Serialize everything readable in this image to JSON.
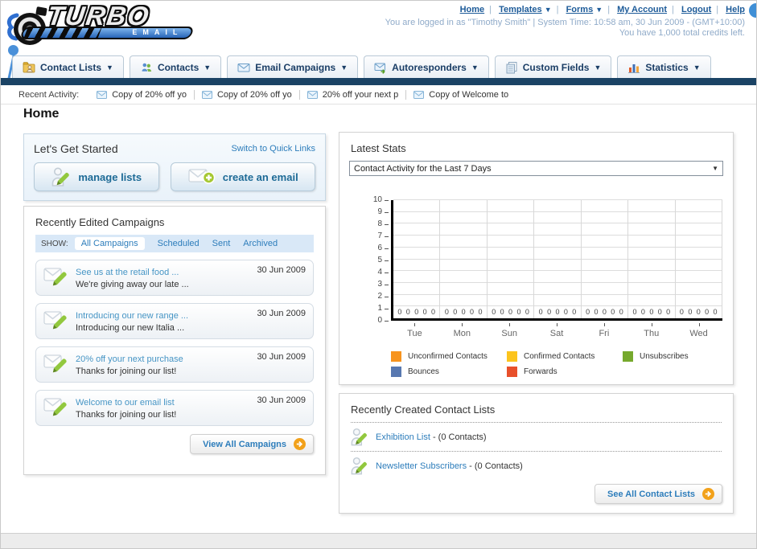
{
  "logo": {
    "title": "TURBO",
    "subtitle": "EMAIL"
  },
  "topnav": {
    "links": [
      {
        "label": "Home",
        "dropdown": false
      },
      {
        "label": "Templates",
        "dropdown": true
      },
      {
        "label": "Forms",
        "dropdown": true
      },
      {
        "label": "My Account",
        "dropdown": false
      },
      {
        "label": "Logout",
        "dropdown": false
      },
      {
        "label": "Help",
        "dropdown": false
      }
    ],
    "status_line1": "You are logged in as \"Timothy Smith\" | System Time: 10:58 am, 30 Jun 2009 - (GMT+10:00)",
    "status_line2": "You have 1,000 total credits left."
  },
  "tabs": [
    {
      "label": "Contact Lists"
    },
    {
      "label": "Contacts"
    },
    {
      "label": "Email Campaigns"
    },
    {
      "label": "Autoresponders"
    },
    {
      "label": "Custom Fields"
    },
    {
      "label": "Statistics"
    }
  ],
  "recent_activity": {
    "label": "Recent Activity:",
    "items": [
      "Copy of 20% off yo",
      "Copy of 20% off yo",
      "20% off your next p",
      "Copy of Welcome to"
    ]
  },
  "page_title": "Home",
  "get_started": {
    "title": "Let's Get Started",
    "switch_link": "Switch to Quick Links",
    "manage_lists_label": "manage lists",
    "create_email_label": "create an email"
  },
  "campaigns": {
    "title": "Recently Edited Campaigns",
    "show_label": "SHOW:",
    "filters": [
      "All Campaigns",
      "Scheduled",
      "Sent",
      "Archived"
    ],
    "active_filter": "All Campaigns",
    "items": [
      {
        "title": "See us at the retail food ...",
        "subtitle": "We're giving away our late ...",
        "date": "30 Jun 2009"
      },
      {
        "title": "Introducing our new range ...",
        "subtitle": "Introducing our new Italia ...",
        "date": "30 Jun 2009"
      },
      {
        "title": "20% off your next purchase",
        "subtitle": "Thanks for joining our list!",
        "date": "30 Jun 2009"
      },
      {
        "title": "Welcome to our email list",
        "subtitle": "Thanks for joining our list!",
        "date": "30 Jun 2009"
      }
    ],
    "view_all_label": "View All Campaigns"
  },
  "stats": {
    "title": "Latest Stats",
    "selected_option": "Contact Activity for the Last 7 Days"
  },
  "chart_data": {
    "type": "bar",
    "title": "Contact Activity for the Last 7 Days",
    "categories": [
      "Tue",
      "Mon",
      "Sun",
      "Sat",
      "Fri",
      "Thu",
      "Wed"
    ],
    "series": [
      {
        "name": "Unconfirmed Contacts",
        "color": "#F7941E",
        "values": [
          0,
          0,
          0,
          0,
          0,
          0,
          0
        ]
      },
      {
        "name": "Confirmed Contacts",
        "color": "#FCC41D",
        "values": [
          0,
          0,
          0,
          0,
          0,
          0,
          0
        ]
      },
      {
        "name": "Unsubscribes",
        "color": "#76A92D",
        "values": [
          0,
          0,
          0,
          0,
          0,
          0,
          0
        ]
      },
      {
        "name": "Bounces",
        "color": "#5878B0",
        "values": [
          0,
          0,
          0,
          0,
          0,
          0,
          0
        ]
      },
      {
        "name": "Forwards",
        "color": "#E8502B",
        "values": [
          0,
          0,
          0,
          0,
          0,
          0,
          0
        ]
      }
    ],
    "xlabel": "",
    "ylabel": "",
    "ylim": [
      0,
      10
    ],
    "ytick_step": 1,
    "grid": true,
    "legend_position": "bottom"
  },
  "contact_lists": {
    "title": "Recently Created Contact Lists",
    "items": [
      {
        "name": "Exhibition List",
        "detail": "- (0 Contacts)"
      },
      {
        "name": "Newsletter Subscribers",
        "detail": "- (0 Contacts)"
      }
    ],
    "see_all_label": "See All Contact Lists"
  }
}
